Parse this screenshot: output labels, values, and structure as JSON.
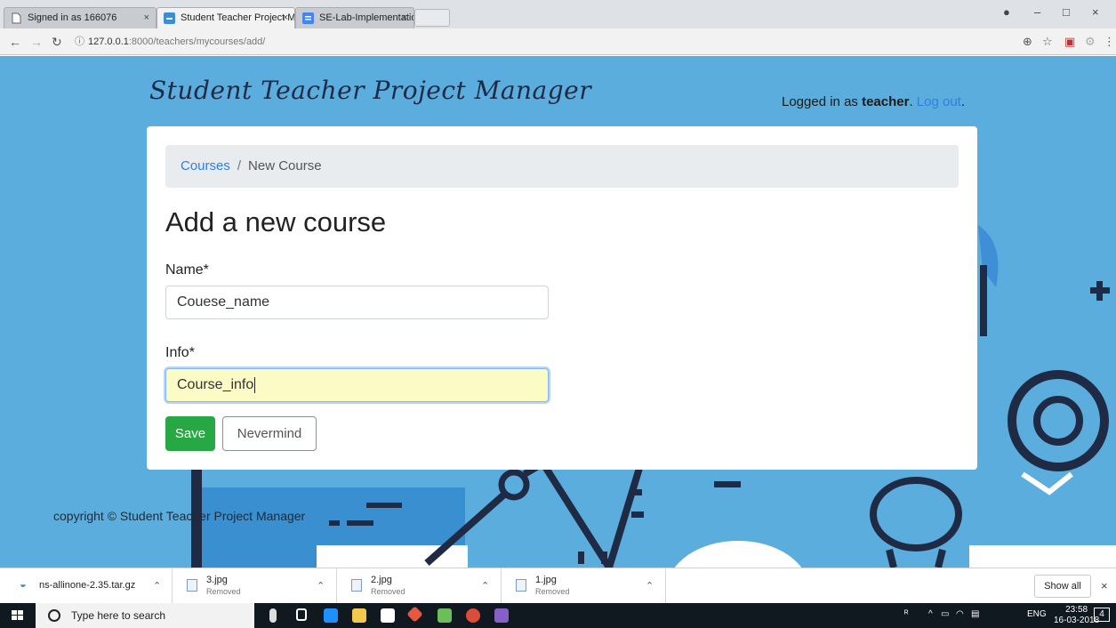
{
  "browser": {
    "tabs": [
      {
        "title": "Signed in as 166076",
        "active": false
      },
      {
        "title": "Student Teacher Project M",
        "active": true
      },
      {
        "title": "SE-Lab-Implementation-",
        "active": false
      }
    ],
    "url_host": "127.0.0.1",
    "url_rest": ":8000/teachers/mycourses/add/"
  },
  "site": {
    "brand": "Student Teacher Project Manager",
    "login_prefix": "Logged in as ",
    "login_user": "teacher",
    "login_period": ".",
    "logout_label": "Log out",
    "logout_period": "."
  },
  "breadcrumb": {
    "root": "Courses",
    "separator": "/",
    "current": "New Course"
  },
  "form": {
    "heading": "Add a new course",
    "name_label": "Name*",
    "name_value": "Couese_name",
    "info_label": "Info*",
    "info_value": "Course_info",
    "save_label": "Save",
    "cancel_label": "Nevermind"
  },
  "footer": {
    "copyright": "copyright © Student Teacher Project Manager"
  },
  "downloads": {
    "items": [
      {
        "name": "ns-allinone-2.35.tar.gz",
        "status": ""
      },
      {
        "name": "3.jpg",
        "status": "Removed"
      },
      {
        "name": "2.jpg",
        "status": "Removed"
      },
      {
        "name": "1.jpg",
        "status": "Removed"
      }
    ],
    "show_all": "Show all"
  },
  "taskbar": {
    "search_placeholder": "Type here to search",
    "lang": "ENG",
    "time": "23:58",
    "date": "16-03-2018",
    "notifications": "4"
  },
  "colors": {
    "page_bg": "#5badde",
    "save_button": "#28a745",
    "link": "#2f7fe0",
    "focused_field": "#fbfbc5"
  }
}
